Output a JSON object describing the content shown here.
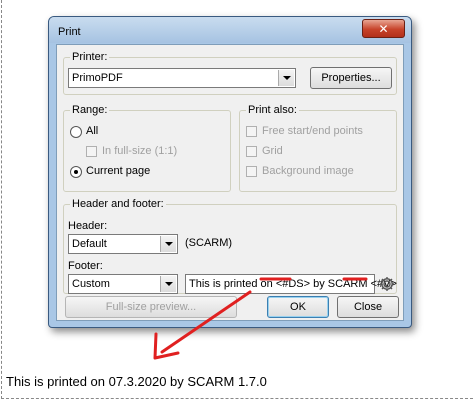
{
  "window": {
    "title": "Print",
    "close_label": "✕"
  },
  "printer": {
    "group_label": "Printer:",
    "selected": "PrimoPDF",
    "properties_label": "Properties..."
  },
  "range": {
    "group_label": "Range:",
    "all_label": "All",
    "full_size_label": "In full-size (1:1)",
    "current_page_label": "Current page",
    "selected": "Current page"
  },
  "print_also": {
    "group_label": "Print also:",
    "options": [
      "Free start/end points",
      "Grid",
      "Background image"
    ]
  },
  "header_footer": {
    "group_label": "Header and footer:",
    "header_label": "Header:",
    "header_selected": "Default",
    "header_text": "(SCARM)",
    "footer_label": "Footer:",
    "footer_selected": "Custom",
    "footer_text": "This is printed on <#DS> by SCARM <#V>"
  },
  "buttons": {
    "preview_label": "Full-size preview...",
    "ok_label": "OK",
    "close_label": "Close"
  },
  "result_caption": "This is printed on 07.3.2020 by SCARM 1.7.0",
  "colors": {
    "annotation_red": "#e02020"
  }
}
